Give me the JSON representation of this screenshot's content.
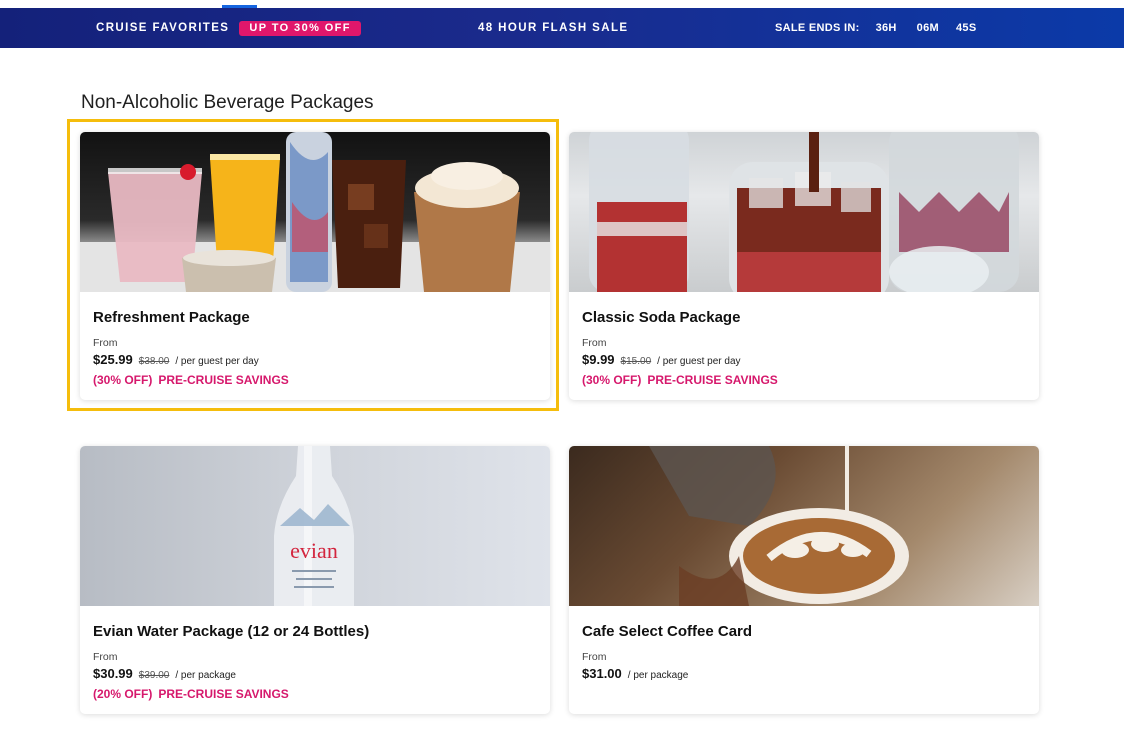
{
  "promo": {
    "left_label": "CRUISE FAVORITES",
    "badge": "UP TO 30% OFF",
    "center_label": "48 HOUR FLASH SALE",
    "timer_label": "SALE ENDS IN:",
    "hours": "36H",
    "minutes": "06M",
    "seconds": "45S",
    "colors": {
      "bar": "#14217a",
      "badge": "#e0176b"
    }
  },
  "section": {
    "title": "Non-Alcoholic Beverage Packages"
  },
  "cards": [
    {
      "name": "Refreshment Package",
      "from": "From",
      "price": "$25.99",
      "original": "$38.00",
      "per": "/ per guest per day",
      "discount": "(30% OFF)",
      "savings": "PRE-CRUISE SAVINGS",
      "selected": true
    },
    {
      "name": "Classic Soda Package",
      "from": "From",
      "price": "$9.99",
      "original": "$15.00",
      "per": "/ per guest per day",
      "discount": "(30% OFF)",
      "savings": "PRE-CRUISE SAVINGS"
    },
    {
      "name": "Evian Water Package (12 or 24 Bottles)",
      "from": "From",
      "price": "$30.99",
      "original": "$39.00",
      "per": "/ per package",
      "discount": "(20% OFF)",
      "savings": "PRE-CRUISE SAVINGS",
      "image_text": "evian"
    },
    {
      "name": "Cafe Select Coffee Card",
      "from": "From",
      "price": "$31.00",
      "per": "/ per package"
    }
  ],
  "colors": {
    "accent": "#d6186c",
    "highlight": "#f5bd0c"
  }
}
